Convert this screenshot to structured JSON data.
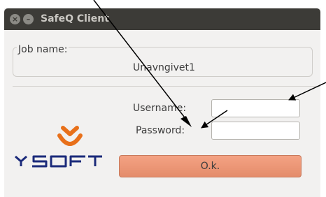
{
  "window": {
    "title": "SafeQ Client",
    "close_glyph": "×",
    "minimize_glyph": "–"
  },
  "form": {
    "job_name_label": "Job name:",
    "job_name_value": "Unavngivet1",
    "username_label": "Username:",
    "password_label": "Password:",
    "username_value": "",
    "password_value": "",
    "ok_label": "O.k."
  },
  "logo": {
    "text": "YSOFT",
    "brand_color": "#e8701a",
    "text_color": "#1b2a7a"
  },
  "colors": {
    "titlebar": "#3c3b37",
    "ok_button": "#e8967a",
    "annotation_arrows": "#000000"
  }
}
